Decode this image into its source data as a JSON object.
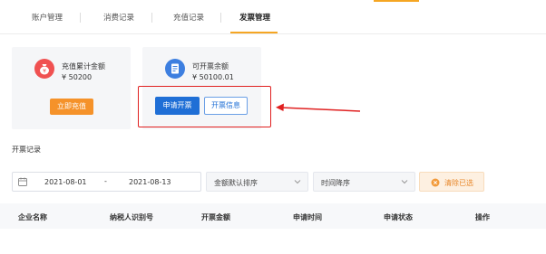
{
  "tabs": [
    {
      "label": "账户管理"
    },
    {
      "label": "消费记录"
    },
    {
      "label": "充值记录"
    },
    {
      "label": "发票管理"
    }
  ],
  "cards": {
    "recharge": {
      "title": "充值累计金额",
      "value": "¥ 50200",
      "icon": "money-bag-icon",
      "color": "#f05151"
    },
    "invoice": {
      "title": "可开票余额",
      "value": "¥ 50100.01",
      "icon": "invoice-icon",
      "color": "#3d7fe0"
    }
  },
  "buttons": {
    "recharge": "立即充值",
    "apply_invoice": "申请开票",
    "invoice_info": "开票信息",
    "clear": "清除已选"
  },
  "section_title": "开票记录",
  "filters": {
    "start_date": "2021-08-01",
    "separator": "-",
    "end_date": "2021-08-13",
    "amount_sort": "金额默认排序",
    "time_sort": "时间降序"
  },
  "table": {
    "columns": [
      "企业名称",
      "纳税人识别号",
      "开票金额",
      "申请时间",
      "申请状态",
      "操作"
    ]
  },
  "colors": {
    "accent": "#f5a623",
    "primary": "#1f6fd6",
    "orange_button": "#f5922a",
    "highlight": "#e02020"
  }
}
